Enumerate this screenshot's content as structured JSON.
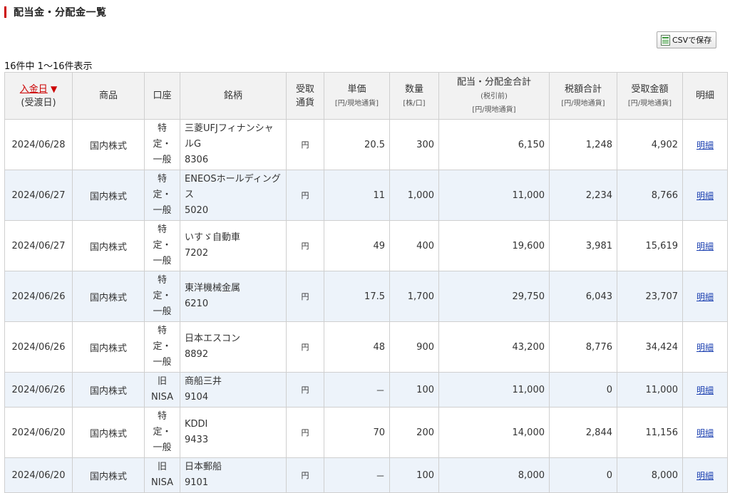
{
  "page": {
    "title": "配当金・分配金一覧",
    "csv_button_label": "CSVで保存",
    "result_count": "16件中 1〜16件表示"
  },
  "table": {
    "headers": {
      "date": "入金日",
      "date_sort_indicator": "▼",
      "date_sub": "(受渡日)",
      "product": "商品",
      "account": "口座",
      "issue": "銘柄",
      "currency_line1": "受取",
      "currency_line2": "通貨",
      "unit_price": "単価",
      "unit_price_unit": "[円/現地通貨]",
      "quantity": "数量",
      "quantity_unit": "[株/口]",
      "dividend_total": "配当・分配金合計",
      "dividend_total_sub": "(税引前)",
      "dividend_total_unit": "[円/現地通貨]",
      "tax_total": "税額合計",
      "tax_total_unit": "[円/現地通貨]",
      "received_amount": "受取金額",
      "received_amount_unit": "[円/現地通貨]",
      "detail": "明細"
    },
    "rows": [
      {
        "date": "2024/06/28",
        "product": "国内株式",
        "account": [
          "特",
          "定・",
          "一般"
        ],
        "issue_name": "三菱UFJフィナンシャルG",
        "issue_code": "8306",
        "currency": "円",
        "unit_price": "20.5",
        "quantity": "300",
        "dividend_total": "6,150",
        "tax_total": "1,248",
        "received_amount": "4,902",
        "detail": "明細"
      },
      {
        "date": "2024/06/27",
        "product": "国内株式",
        "account": [
          "特",
          "定・",
          "一般"
        ],
        "issue_name": "ENEOSホールディングス",
        "issue_code": "5020",
        "currency": "円",
        "unit_price": "11",
        "quantity": "1,000",
        "dividend_total": "11,000",
        "tax_total": "2,234",
        "received_amount": "8,766",
        "detail": "明細"
      },
      {
        "date": "2024/06/27",
        "product": "国内株式",
        "account": [
          "特",
          "定・",
          "一般"
        ],
        "issue_name": "いすゞ自動車",
        "issue_code": "7202",
        "currency": "円",
        "unit_price": "49",
        "quantity": "400",
        "dividend_total": "19,600",
        "tax_total": "3,981",
        "received_amount": "15,619",
        "detail": "明細"
      },
      {
        "date": "2024/06/26",
        "product": "国内株式",
        "account": [
          "特",
          "定・",
          "一般"
        ],
        "issue_name": "東洋機械金属",
        "issue_code": "6210",
        "currency": "円",
        "unit_price": "17.5",
        "quantity": "1,700",
        "dividend_total": "29,750",
        "tax_total": "6,043",
        "received_amount": "23,707",
        "detail": "明細"
      },
      {
        "date": "2024/06/26",
        "product": "国内株式",
        "account": [
          "特",
          "定・",
          "一般"
        ],
        "issue_name": "日本エスコン",
        "issue_code": "8892",
        "currency": "円",
        "unit_price": "48",
        "quantity": "900",
        "dividend_total": "43,200",
        "tax_total": "8,776",
        "received_amount": "34,424",
        "detail": "明細"
      },
      {
        "date": "2024/06/26",
        "product": "国内株式",
        "account": [
          "旧",
          "NISA"
        ],
        "issue_name": "商船三井",
        "issue_code": "9104",
        "currency": "円",
        "unit_price": "－",
        "quantity": "100",
        "dividend_total": "11,000",
        "tax_total": "0",
        "received_amount": "11,000",
        "detail": "明細"
      },
      {
        "date": "2024/06/20",
        "product": "国内株式",
        "account": [
          "特",
          "定・",
          "一般"
        ],
        "issue_name": "KDDI",
        "issue_code": "9433",
        "currency": "円",
        "unit_price": "70",
        "quantity": "200",
        "dividend_total": "14,000",
        "tax_total": "2,844",
        "received_amount": "11,156",
        "detail": "明細"
      },
      {
        "date": "2024/06/20",
        "product": "国内株式",
        "account": [
          "旧",
          "NISA"
        ],
        "issue_name": "日本郵船",
        "issue_code": "9101",
        "currency": "円",
        "unit_price": "－",
        "quantity": "100",
        "dividend_total": "8,000",
        "tax_total": "0",
        "received_amount": "8,000",
        "detail": "明細"
      }
    ]
  },
  "colors": {
    "accent_red": "#cc0000",
    "link_blue": "#1a3fb0",
    "row_alt": "#edf3fa",
    "header_bg": "#f2f2f2"
  },
  "icons": {
    "csv": "spreadsheet-icon"
  }
}
